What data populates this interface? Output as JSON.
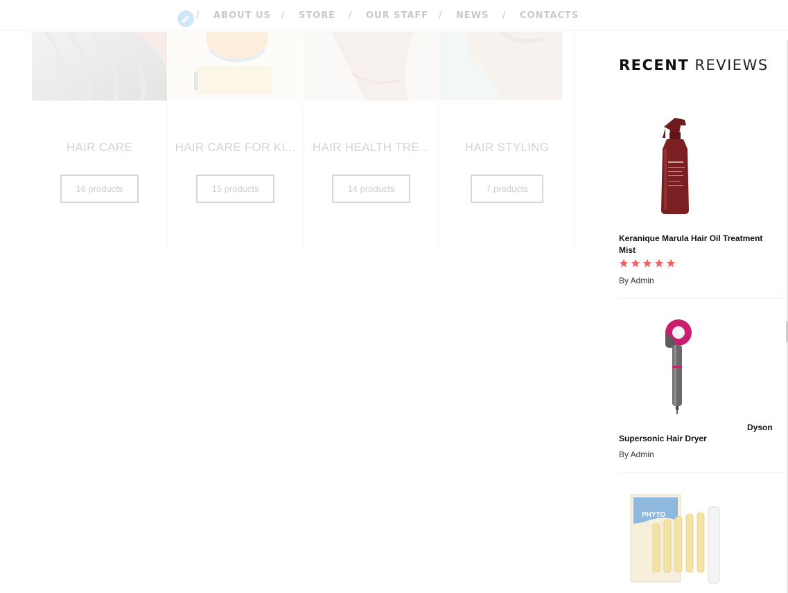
{
  "nav": {
    "items": [
      "ABOUT US",
      "STORE",
      "OUR STAFF",
      "NEWS",
      "CONTACTS"
    ],
    "separator": "/"
  },
  "categories": [
    {
      "title": "HAIR CARE",
      "count": "16 products"
    },
    {
      "title": "HAIR CARE FOR KI...",
      "count": "15 products"
    },
    {
      "title": "HAIR HEALTH TRE...",
      "count": "14 products"
    },
    {
      "title": "HAIR STYLING",
      "count": "7 products"
    }
  ],
  "sidebar": {
    "title_bold": "RECENT",
    "title_light": "REVIEWS",
    "reviews": [
      {
        "name": "Keranique Marula Hair Oil Treatment Mist",
        "rating": 5,
        "author": "By Admin"
      },
      {
        "brand": "Dyson",
        "name": "Supersonic Hair Dryer",
        "author": "By Admin"
      },
      {
        "brand_logo": "PHYTO"
      }
    ]
  },
  "colors": {
    "star": "#f0625f",
    "bottle": "#7a1f22",
    "dryer_accent": "#c8206e"
  }
}
